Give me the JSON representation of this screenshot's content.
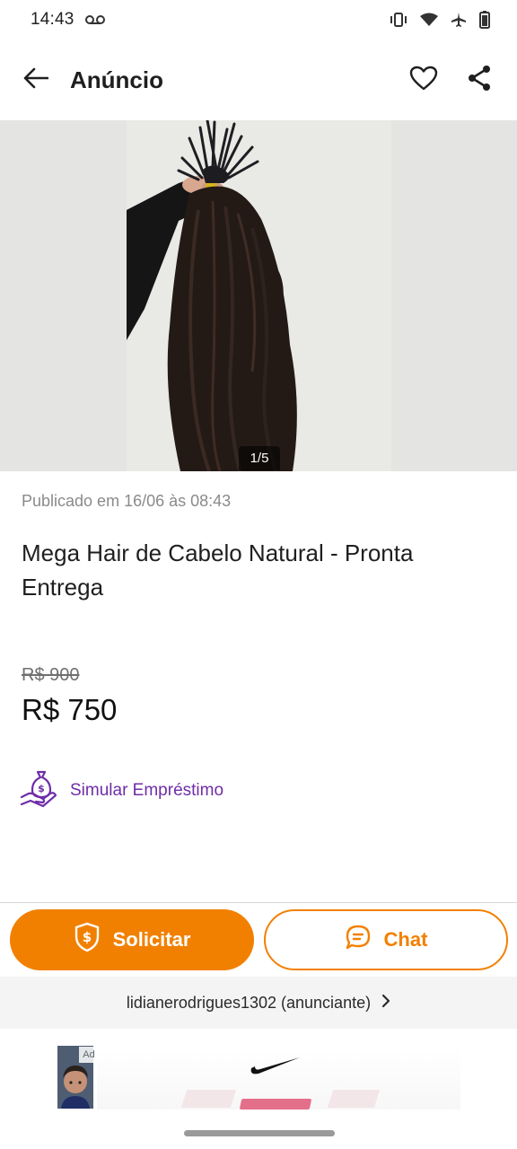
{
  "status_bar": {
    "time": "14:43",
    "icons": [
      "voicemail-icon",
      "vibrate-icon",
      "wifi-icon",
      "airplane-icon",
      "battery-icon"
    ]
  },
  "app_bar": {
    "title": "Anúncio",
    "icons": [
      "back-arrow-icon",
      "heart-icon",
      "share-icon"
    ]
  },
  "gallery": {
    "page_indicator": "1/5"
  },
  "listing": {
    "published": "Publicado em 16/06 às 08:43",
    "title": "Mega Hair de Cabelo Natural - Pronta Entrega",
    "old_price": "R$ 900",
    "price": "R$ 750"
  },
  "loan": {
    "label": "Simular Empréstimo",
    "icon": "money-bag-hand-icon",
    "color": "#6f2da8"
  },
  "actions": {
    "solicitar_label": "Solicitar",
    "chat_label": "Chat",
    "accent_color": "#f28000"
  },
  "seller": {
    "label": "lidianerodrigues1302 (anunciante)"
  },
  "ad": {
    "badge": "Ad",
    "logo": "swoosh-logo-icon"
  }
}
